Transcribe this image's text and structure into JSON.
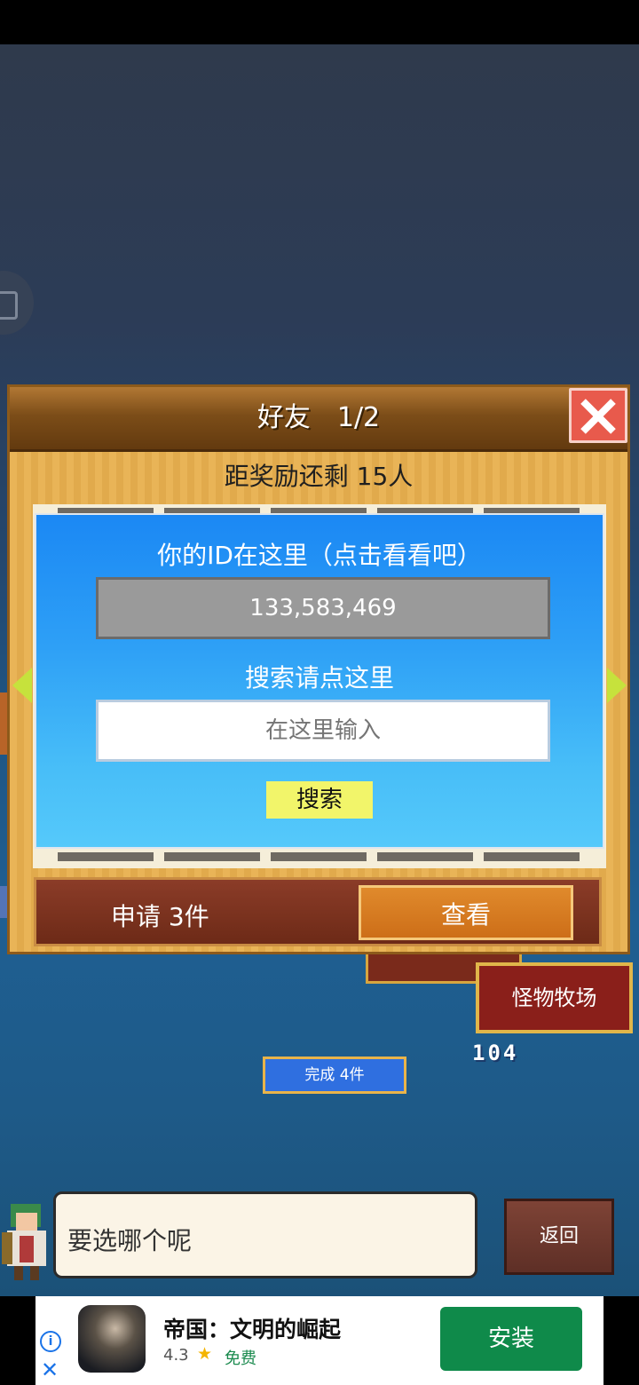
{
  "dialog": {
    "title": "好友　1/2",
    "reward_text": "距奖励还剩 15人",
    "id_label": "你的ID在这里（点击看看吧）",
    "id_value": "133,583,469",
    "search_label": "搜索请点这里",
    "search_placeholder": "在这里输入",
    "search_button": "搜索",
    "request_text": "申请 3件",
    "view_button": "查看"
  },
  "game": {
    "ranch_label": "怪物牧场",
    "ranch_count": "104",
    "done_badge": "完成 4件",
    "speech": "要选哪个呢",
    "back_button": "返回"
  },
  "ad": {
    "title": "帝国：文明的崛起",
    "rating": "4.3",
    "star": "★",
    "price": "免费",
    "install": "安装",
    "info_glyph": "i",
    "close_glyph": "✕"
  }
}
